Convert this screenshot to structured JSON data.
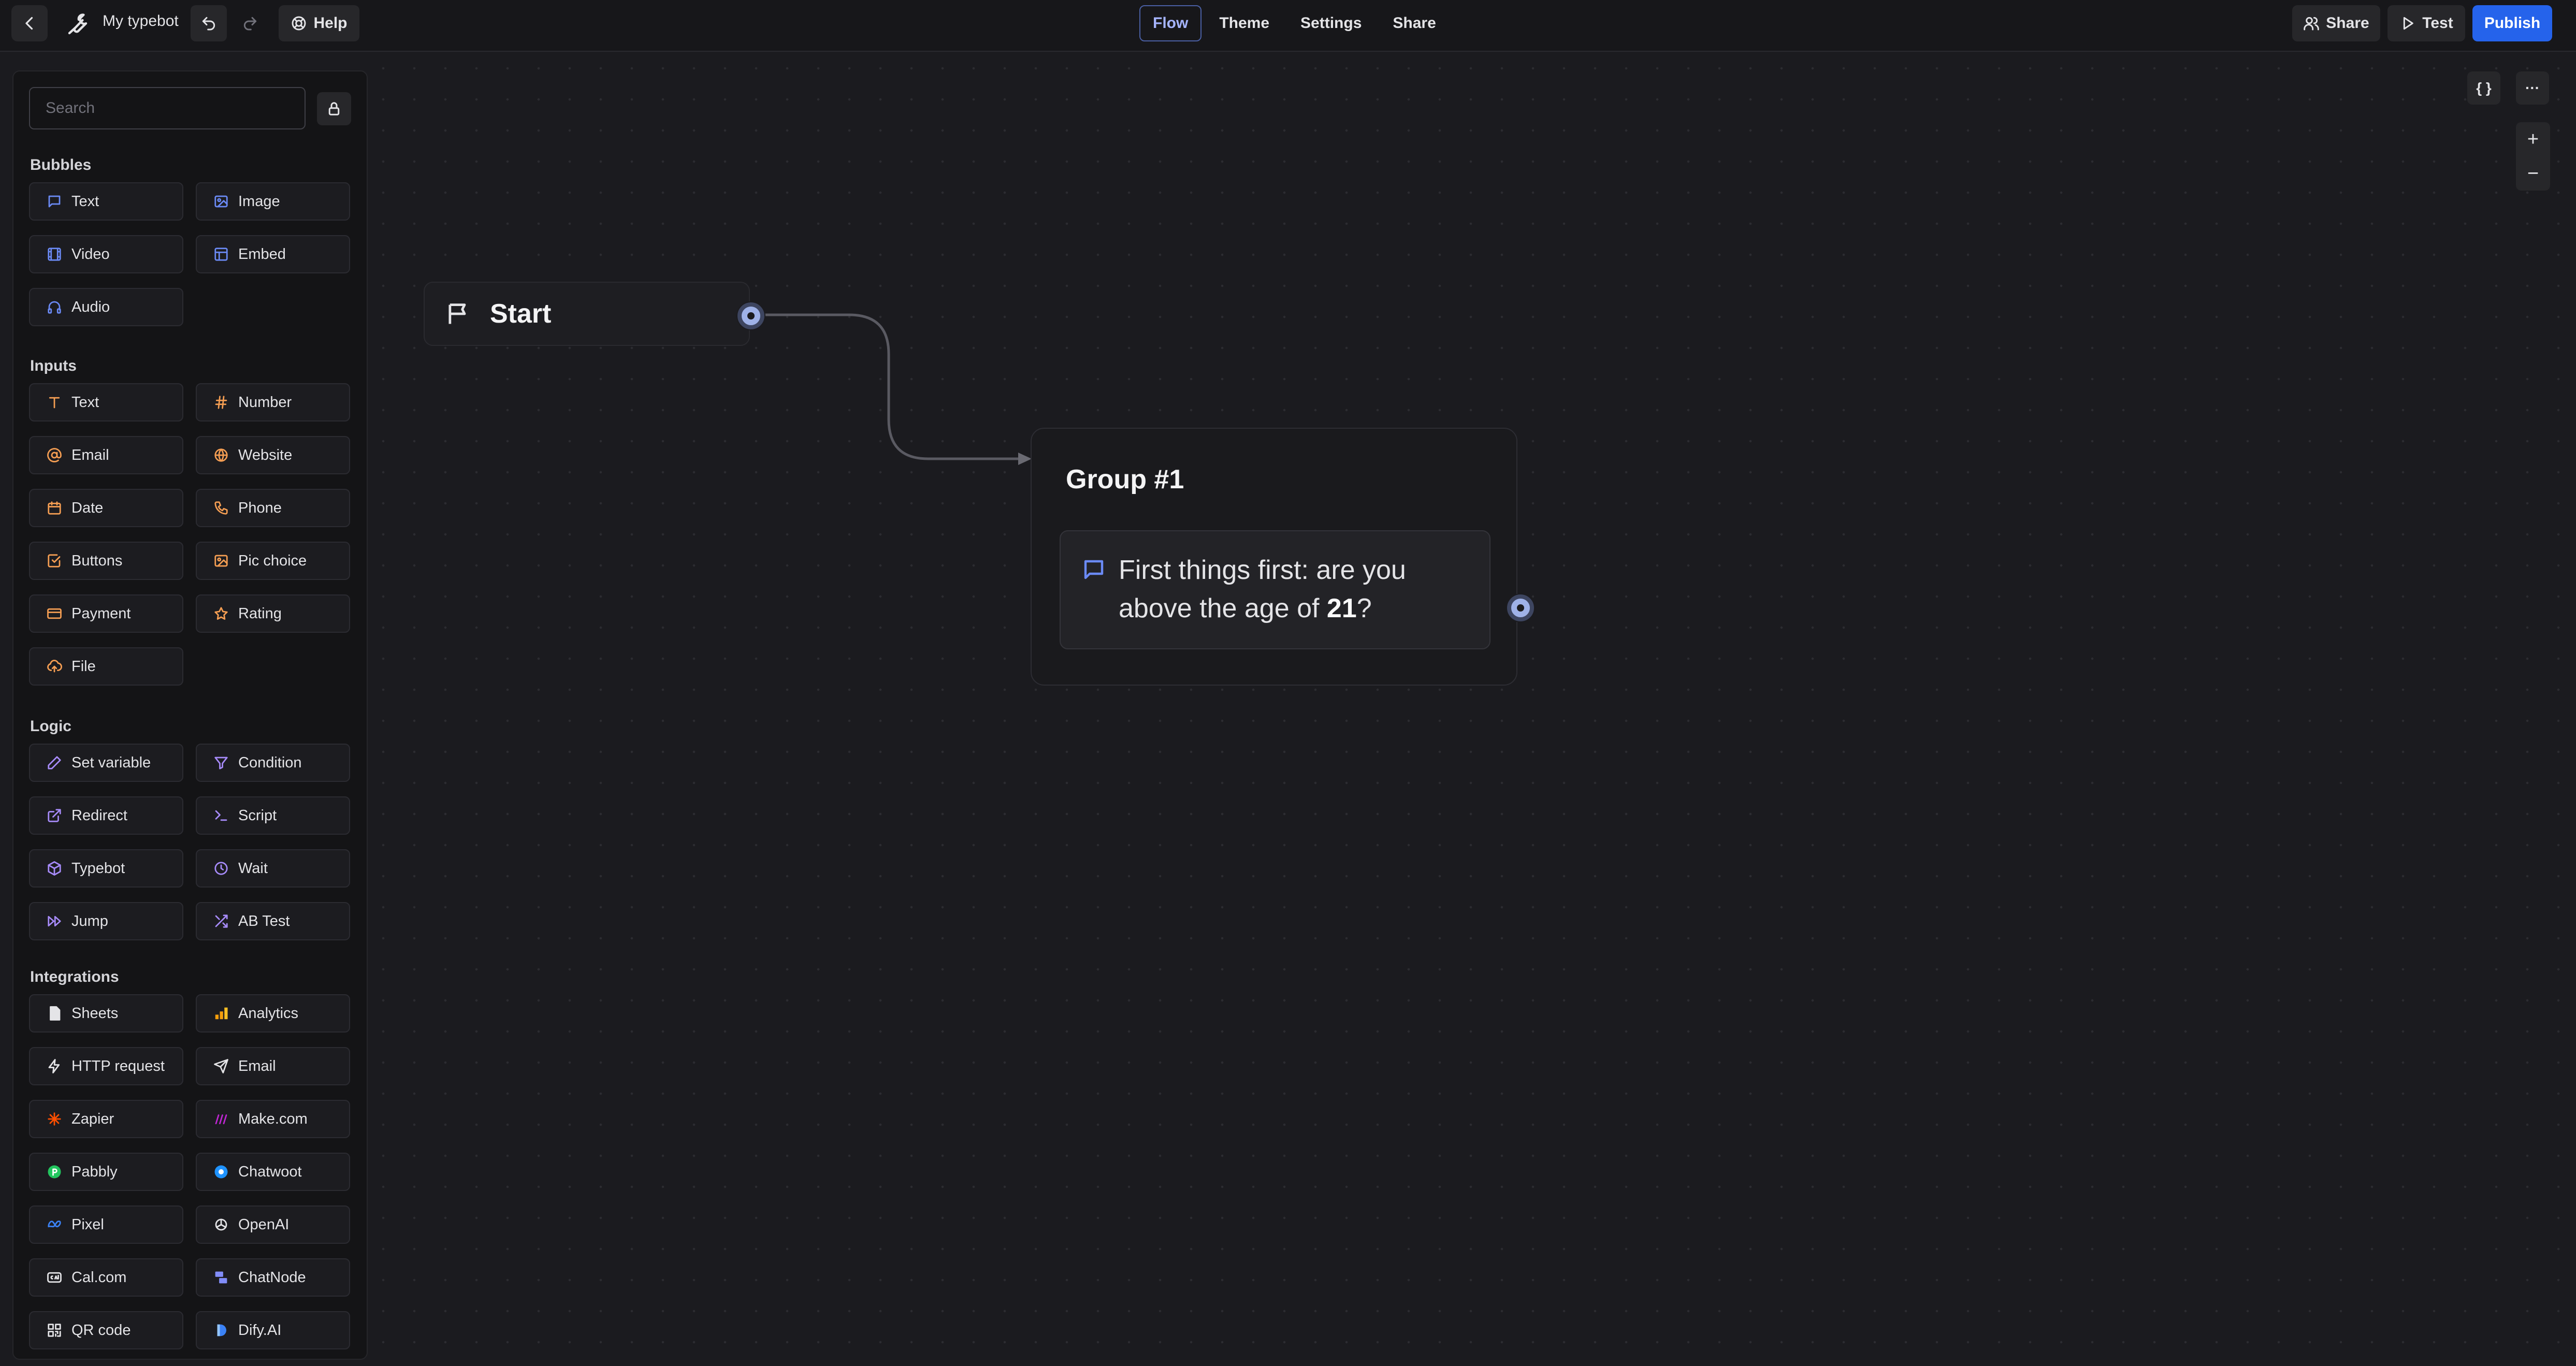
{
  "header": {
    "typebot_name": "My typebot",
    "help_label": "Help",
    "tabs": [
      "Flow",
      "Theme",
      "Settings",
      "Share"
    ],
    "active_tab": "Flow",
    "share_label": "Share",
    "test_label": "Test",
    "publish_label": "Publish"
  },
  "sidebar": {
    "search_placeholder": "Search",
    "sections": {
      "bubbles": "Bubbles",
      "inputs": "Inputs",
      "logic": "Logic",
      "integrations": "Integrations"
    },
    "bubbles": [
      "Text",
      "Image",
      "Video",
      "Embed",
      "Audio"
    ],
    "inputs": [
      "Text",
      "Number",
      "Email",
      "Website",
      "Date",
      "Phone",
      "Buttons",
      "Pic choice",
      "Payment",
      "Rating",
      "File"
    ],
    "logic": [
      "Set variable",
      "Condition",
      "Redirect",
      "Script",
      "Typebot",
      "Wait",
      "Jump",
      "AB Test"
    ],
    "integrations": [
      "Sheets",
      "Analytics",
      "HTTP request",
      "Email",
      "Zapier",
      "Make.com",
      "Pabbly",
      "Chatwoot",
      "Pixel",
      "OpenAI",
      "Cal.com",
      "ChatNode",
      "QR code",
      "Dify.AI"
    ]
  },
  "canvas": {
    "variables_button": "{ }",
    "more_button": "···",
    "zoom_in": "+",
    "zoom_out": "−",
    "start_label": "Start",
    "group_title": "Group #1",
    "block_text_before": "First things first: are you above the age of ",
    "block_text_bold": "21",
    "block_text_after": "?"
  },
  "colors": {
    "accent": "#2563eb",
    "bubble_icon": "#6b8af5",
    "input_icon": "#f59e53",
    "logic_icon": "#a78bfa",
    "background": "#1b1b1f"
  }
}
